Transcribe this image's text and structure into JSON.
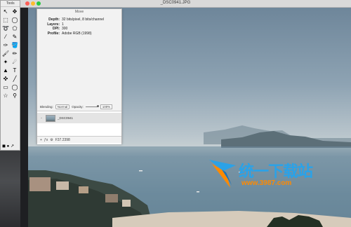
{
  "window": {
    "title": "_DSC0941.JPG"
  },
  "toolbox": {
    "title": "Tools",
    "tools": [
      {
        "icon": "arrow-icon",
        "glyph": "↖"
      },
      {
        "icon": "move-icon",
        "glyph": "✥"
      },
      {
        "icon": "rect-select-icon",
        "glyph": "⬚"
      },
      {
        "icon": "ellipse-select-icon",
        "glyph": "◯"
      },
      {
        "icon": "lasso-icon",
        "glyph": "➰"
      },
      {
        "icon": "poly-lasso-icon",
        "glyph": "⬠"
      },
      {
        "icon": "magic-wand-icon",
        "glyph": "⁄"
      },
      {
        "icon": "quick-select-icon",
        "glyph": "✎"
      },
      {
        "icon": "eyedropper-icon",
        "glyph": "✑"
      },
      {
        "icon": "paint-bucket-icon",
        "glyph": "🪣"
      },
      {
        "icon": "brush-icon",
        "glyph": "🖌"
      },
      {
        "icon": "pencil-icon",
        "glyph": "✏"
      },
      {
        "icon": "clone-icon",
        "glyph": "✦"
      },
      {
        "icon": "smudge-icon",
        "glyph": "☄"
      },
      {
        "icon": "burn-icon",
        "glyph": "▲"
      },
      {
        "icon": "text-icon",
        "glyph": "T"
      },
      {
        "icon": "shape-icon",
        "glyph": "✜"
      },
      {
        "icon": "line-icon",
        "glyph": "╱"
      },
      {
        "icon": "rectangle-icon",
        "glyph": "▭"
      },
      {
        "icon": "ellipse-icon",
        "glyph": "◯"
      },
      {
        "icon": "star-icon",
        "glyph": "☆"
      },
      {
        "icon": "zoom-icon",
        "glyph": "⚲"
      }
    ],
    "swatch_glyphs": "◼ ● ↗"
  },
  "inspector": {
    "title": "Move",
    "info": [
      {
        "label": "Depth:",
        "value": "32 bits/pixel, 8 bits/channel"
      },
      {
        "label": "Layers:",
        "value": "1"
      },
      {
        "label": "DPI:",
        "value": "300"
      },
      {
        "label": "Profile:",
        "value": "Adobe RGB (1998)"
      }
    ],
    "blending_label": "Blending:",
    "blending_value": "Normal",
    "opacity_label": "Opacity:",
    "opacity_value": "100%",
    "layer_name": "_DSC0941",
    "footer_coords": "F37.2398"
  },
  "watermark": {
    "brand": "统一下载站",
    "url": "www.3987.com"
  }
}
